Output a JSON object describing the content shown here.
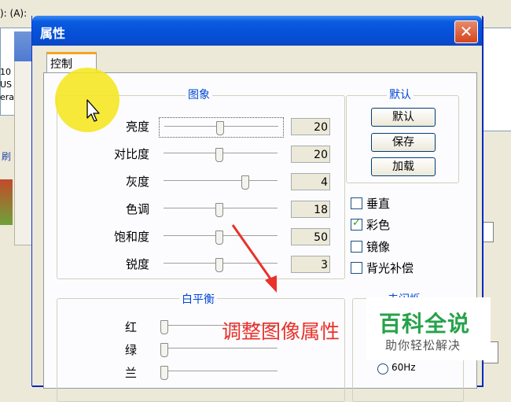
{
  "background": {
    "top_label": "):  (A):",
    "side_text": "刷",
    "mid_text": [
      "10",
      "US",
      "era"
    ]
  },
  "dialog": {
    "title": "属性",
    "close_glyph": "✕",
    "tab_label": "控制"
  },
  "image_group": {
    "title": "图象",
    "rows": [
      {
        "label": "亮度",
        "value": "20",
        "level": 0.48
      },
      {
        "label": "对比度",
        "value": "20",
        "level": 0.48
      },
      {
        "label": "灰度",
        "value": "4",
        "level": 0.72
      },
      {
        "label": "色调",
        "value": "18",
        "level": 0.48
      },
      {
        "label": "饱和度",
        "value": "50",
        "level": 0.48
      },
      {
        "label": "锐度",
        "value": "3",
        "level": 0.48
      }
    ]
  },
  "default_group": {
    "title": "默认",
    "buttons": [
      "默认",
      "保存",
      "加载"
    ]
  },
  "checkboxes": [
    {
      "label": "垂直",
      "checked": false
    },
    {
      "label": "彩色",
      "checked": true
    },
    {
      "label": "镜像",
      "checked": false
    },
    {
      "label": "背光补偿",
      "checked": false
    }
  ],
  "white_balance": {
    "title": "白平衡",
    "rows": [
      {
        "label": "红",
        "level": 0.0
      },
      {
        "label": "绿",
        "level": 0.0
      },
      {
        "label": "兰",
        "level": 0.0
      }
    ]
  },
  "flicker_group": {
    "title": "去闪烁",
    "option": "60Hz"
  },
  "annotation": {
    "text": "调整图像属性",
    "color": "#e8322a"
  },
  "watermark": {
    "main": "百科全说",
    "sub": "助你轻松解决"
  }
}
